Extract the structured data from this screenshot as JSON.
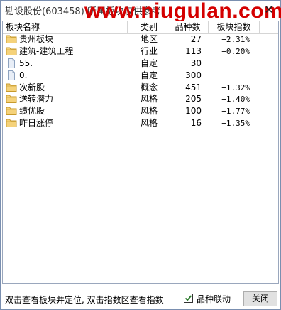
{
  "window": {
    "title": "勘设股份(603458)  所属板块仅供参考",
    "watermark": "www.niugulan.com",
    "close_glyph": "✕"
  },
  "table": {
    "columns": [
      "板块名称",
      "类别",
      "品种数",
      "板块指数"
    ],
    "rows": [
      {
        "icon": "folder",
        "name": "贵州板块",
        "type": "地区",
        "count": "27",
        "index": "+2.31%"
      },
      {
        "icon": "folder",
        "name": "建筑-建筑工程",
        "type": "行业",
        "count": "113",
        "index": "+0.20%"
      },
      {
        "icon": "file",
        "name": "55.",
        "type": "自定",
        "count": "30",
        "index": ""
      },
      {
        "icon": "file",
        "name": "0.",
        "type": "自定",
        "count": "300",
        "index": ""
      },
      {
        "icon": "folder",
        "name": "次新股",
        "type": "概念",
        "count": "451",
        "index": "+1.32%"
      },
      {
        "icon": "folder",
        "name": "送转潜力",
        "type": "风格",
        "count": "205",
        "index": "+1.40%"
      },
      {
        "icon": "folder",
        "name": "绩优股",
        "type": "风格",
        "count": "100",
        "index": "+1.77%"
      },
      {
        "icon": "folder",
        "name": "昨日涨停",
        "type": "风格",
        "count": "16",
        "index": "+1.35%"
      }
    ]
  },
  "footer": {
    "hint": "双击查看板块并定位, 双击指数区查看指数",
    "checkbox_label": "品种联动",
    "checkbox_checked": true,
    "close_label": "关闭"
  },
  "colors": {
    "folder_fill": "#f5d27a",
    "folder_stroke": "#c79a2c",
    "file_fill": "#e8eef7",
    "file_stroke": "#8da2bf",
    "watermark": "#d40000",
    "check": "#2a7a2a"
  }
}
